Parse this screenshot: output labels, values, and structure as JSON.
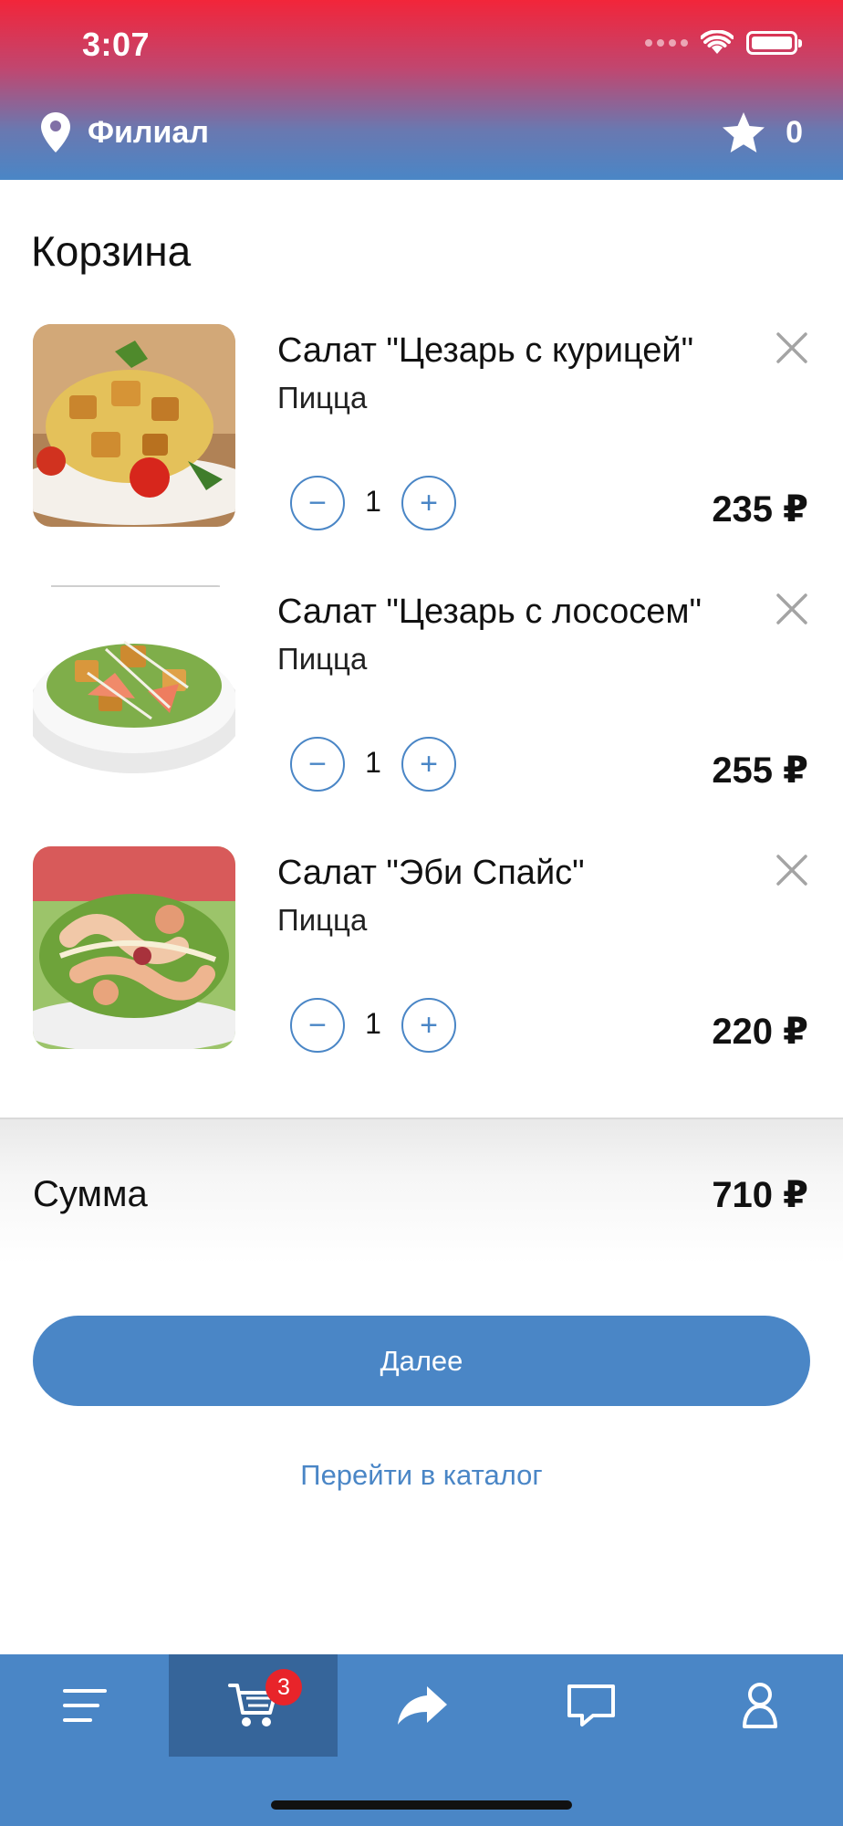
{
  "status_bar": {
    "time": "3:07"
  },
  "header": {
    "branch_label": "Филиал",
    "favorites_count": "0"
  },
  "page": {
    "title": "Корзина"
  },
  "cart": {
    "items": [
      {
        "name": "Салат \"Цезарь с курицей\"",
        "category": "Пицца",
        "quantity": "1",
        "price": "235 ₽"
      },
      {
        "name": "Салат \"Цезарь с лососем\"",
        "category": "Пицца",
        "quantity": "1",
        "price": "255 ₽"
      },
      {
        "name": "Салат \"Эби Спайс\"",
        "category": "Пицца",
        "quantity": "1",
        "price": "220 ₽"
      }
    ],
    "qty_minus_symbol": "−",
    "qty_plus_symbol": "+"
  },
  "summary": {
    "label": "Сумма",
    "total": "710 ₽"
  },
  "actions": {
    "next_label": "Далее",
    "catalog_link": "Перейти в каталог"
  },
  "tabbar": {
    "tabs": [
      {
        "icon": "menu-icon"
      },
      {
        "icon": "cart-icon",
        "badge": "3",
        "active": true
      },
      {
        "icon": "share-icon"
      },
      {
        "icon": "chat-icon"
      },
      {
        "icon": "profile-icon"
      }
    ]
  },
  "colors": {
    "accent": "#4a86c6",
    "active_tab": "#36659a",
    "badge": "#e8242a",
    "header_top": "#f2253a"
  }
}
